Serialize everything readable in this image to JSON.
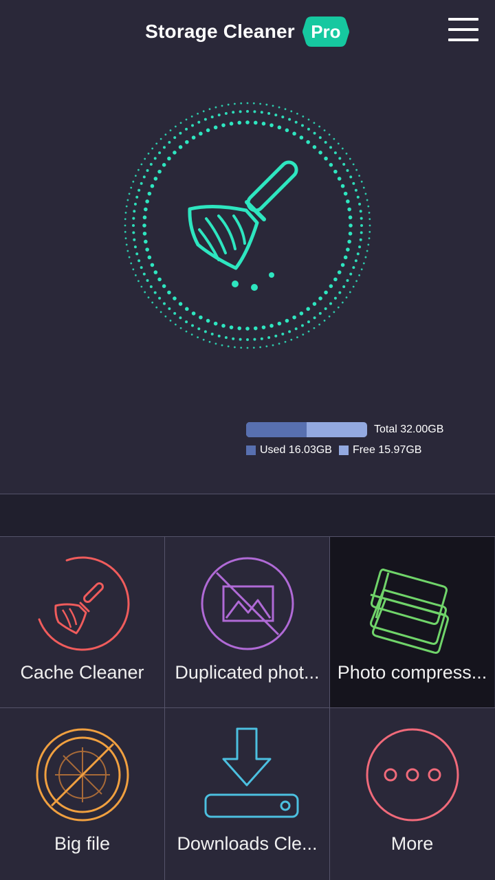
{
  "header": {
    "title": "Storage Cleaner",
    "badge": "Pro"
  },
  "colors": {
    "background": "#2a2839",
    "accent": "#2ee6c0",
    "cache": "#f05c5c",
    "duplicated": "#b06ad6",
    "compress": "#70d46a",
    "bigfile": "#f0a040",
    "downloads": "#4cc0e0",
    "more": "#f06a7a",
    "used": "#5870b0",
    "free": "#93a9e0"
  },
  "storage": {
    "total_label": "Total 32.00GB",
    "used_label": "Used 16.03GB",
    "free_label": "Free 15.97GB",
    "used_fraction": 0.5
  },
  "tiles": [
    {
      "label": "Cache Cleaner",
      "icon": "broom-icon"
    },
    {
      "label": "Duplicated phot...",
      "icon": "no-image-icon"
    },
    {
      "label": "Photo compress...",
      "icon": "photo-stack-icon"
    },
    {
      "label": "Big file",
      "icon": "big-file-icon"
    },
    {
      "label": "Downloads Cle...",
      "icon": "download-icon"
    },
    {
      "label": "More",
      "icon": "more-icon"
    }
  ]
}
